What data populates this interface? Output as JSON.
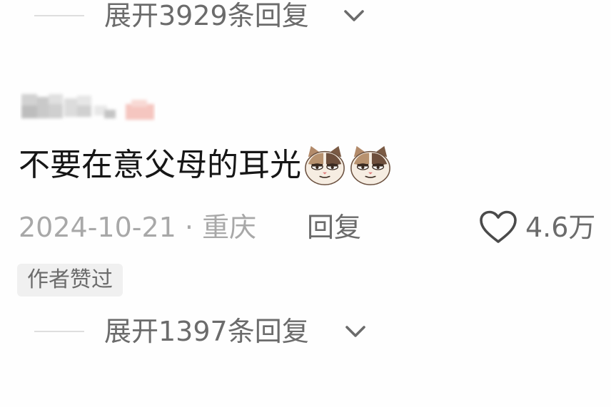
{
  "replies_top": {
    "label": "展开3929条回复",
    "icon": "chevron-down-icon"
  },
  "comment": {
    "text": "不要在意父母的耳光",
    "emojis": [
      "cat-face-emoji",
      "cat-face-emoji"
    ],
    "date_location": "2024-10-21 · 重庆",
    "reply_label": "回复",
    "like_icon": "heart-outline-icon",
    "like_count": "4.6万",
    "author_badge": "作者赞过"
  },
  "replies_bottom": {
    "label": "展开1397条回复",
    "icon": "chevron-down-icon"
  },
  "colors": {
    "background": "#fefefe",
    "primary_text": "#161616",
    "secondary_text": "#6b6b6b",
    "muted_text": "#a8a8a8",
    "badge_bg": "#f0f0f0",
    "divider": "#dedede"
  }
}
